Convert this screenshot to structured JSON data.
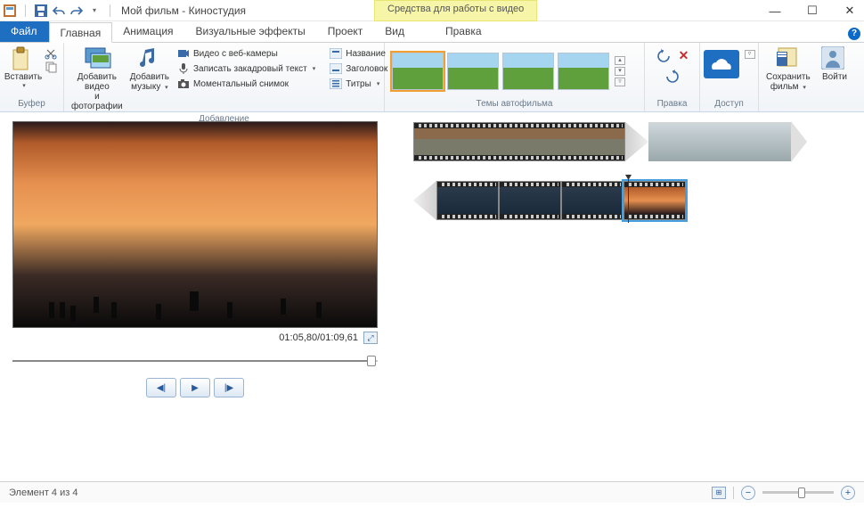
{
  "titlebar": {
    "title": "Мой фильм - Киностудия",
    "context_label": "Средства для работы с видео"
  },
  "tabs": {
    "file": "Файл",
    "home": "Главная",
    "anim": "Анимация",
    "vfx": "Визуальные эффекты",
    "project": "Проект",
    "view": "Вид",
    "edit": "Правка"
  },
  "ribbon": {
    "buffer": {
      "label": "Буфер",
      "paste": "Вставить"
    },
    "add": {
      "label": "Добавление",
      "add_video_l1": "Добавить видео",
      "add_video_l2": "и фотографии",
      "add_music_l1": "Добавить",
      "add_music_l2": "музыку",
      "webcam": "Видео с веб-камеры",
      "narrate": "Записать закадровый текст",
      "snapshot": "Моментальный снимок"
    },
    "text": {
      "title": "Название",
      "caption": "Заголовок",
      "credits": "Титры"
    },
    "themes": {
      "label": "Темы автофильма"
    },
    "edit": {
      "label": "Правка"
    },
    "access": {
      "label": "Доступ"
    },
    "save": {
      "l1": "Сохранить",
      "l2": "фильм"
    },
    "signin": "Войти"
  },
  "preview": {
    "time": "01:05,80/01:09,61"
  },
  "status": {
    "text": "Элемент 4 из 4"
  }
}
